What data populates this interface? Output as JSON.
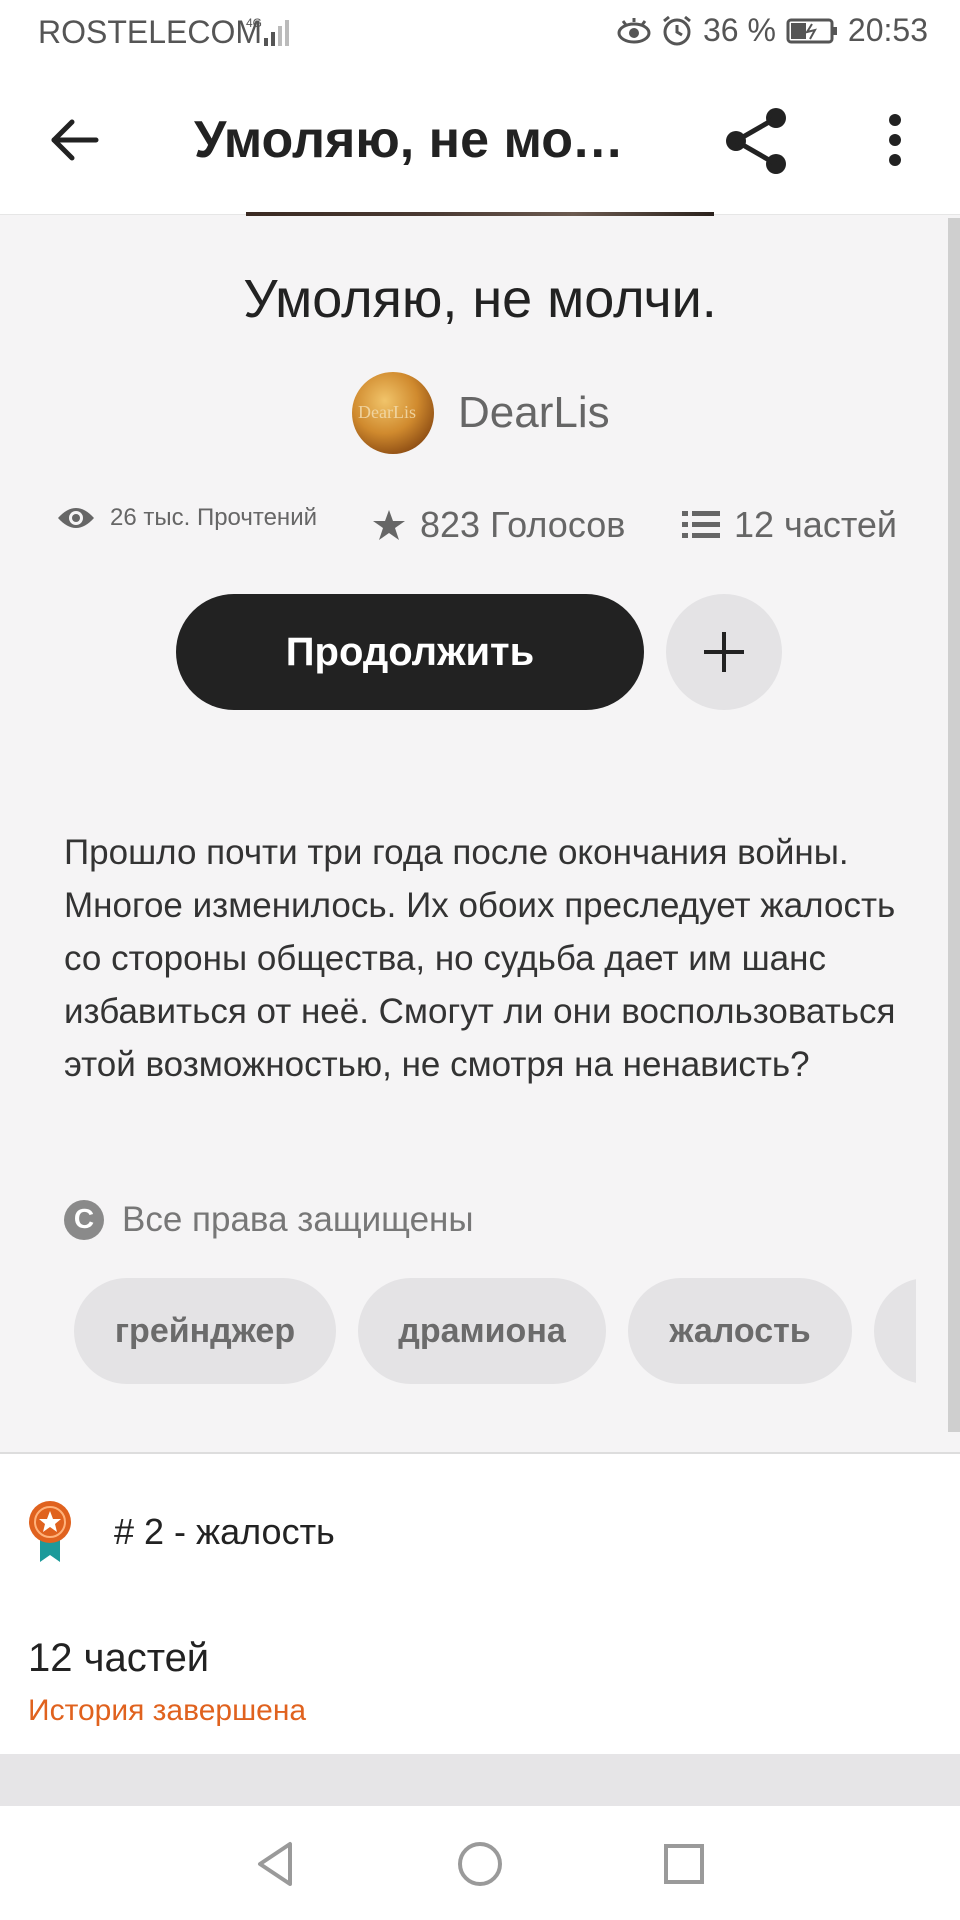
{
  "status_bar": {
    "carrier": "ROSTELECOM",
    "network": "4G",
    "battery": "36 %",
    "time": "20:53"
  },
  "app_bar": {
    "title": "Умоляю, не мол…"
  },
  "story": {
    "title": "Умоляю, не молчи.",
    "author": "DearLis",
    "avatar_text": "DearLis",
    "reads": "26 тыс. Прочтений",
    "votes": "823 Голосов",
    "parts": "12 частей",
    "continue_label": "Продолжить",
    "description": "Прошло почти три года после окончания войны. Многое изменилось. Их обоих преследует жалость со стороны общества, но судьба дает им шанс избавиться от неё. Смогут ли они воспользоваться этой возможностью, не смотря на ненависть?",
    "copyright": "Все права защищены",
    "tags": [
      "грейнджер",
      "драмиона",
      "жалость"
    ]
  },
  "ranking": {
    "label": "# 2 - жалость"
  },
  "toc": {
    "parts": "12 частей",
    "status": "История завершена"
  },
  "colors": {
    "accent": "#e0621e",
    "button_dark": "#222222",
    "tag_bg": "#e4e3e5"
  },
  "icons": [
    "eye-icon",
    "star-icon",
    "list-icon",
    "share-icon",
    "more-vert-icon",
    "plus-icon",
    "copyright-icon",
    "award-badge-icon"
  ]
}
